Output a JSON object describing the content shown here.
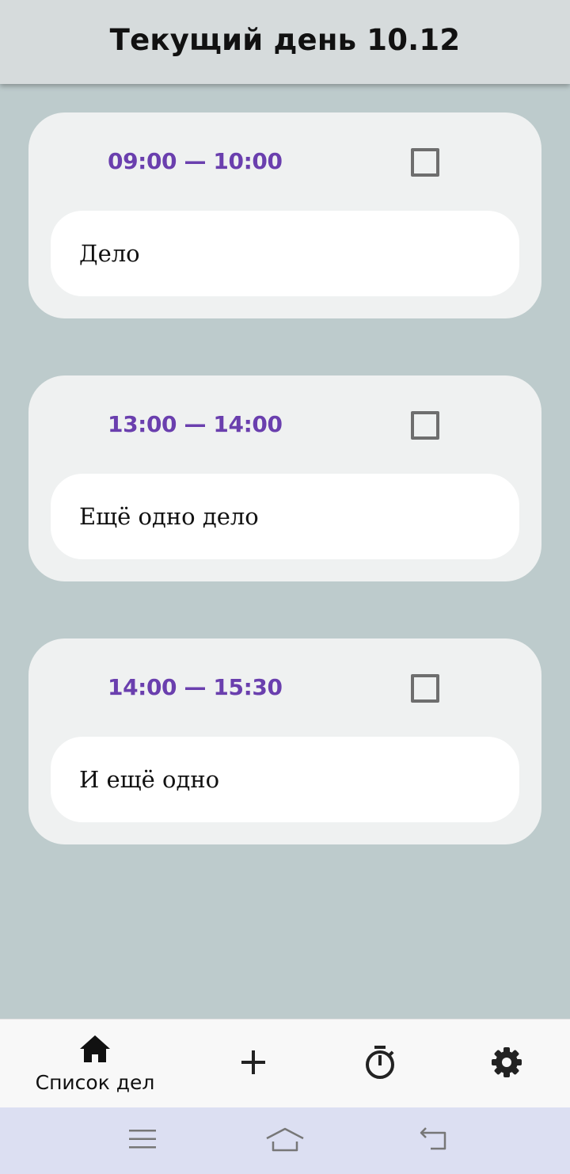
{
  "app_bar": {
    "title": "Текущий день 10.12"
  },
  "tasks": [
    {
      "time": "09:00 — 10:00",
      "text": "Дело",
      "done": false
    },
    {
      "time": "13:00 — 14:00",
      "text": "Ещё одно дело",
      "done": false
    },
    {
      "time": "14:00 — 15:30",
      "text": "И ещё одно",
      "done": false
    }
  ],
  "bottom_nav": {
    "items": [
      {
        "icon": "home-icon",
        "label": "Список дел",
        "active": true
      },
      {
        "icon": "plus-icon"
      },
      {
        "icon": "stopwatch-icon"
      },
      {
        "icon": "gear-icon"
      }
    ]
  },
  "system_nav": {
    "buttons": [
      "menu-icon",
      "home-outline-icon",
      "back-icon"
    ]
  },
  "colors": {
    "background": "#bdcbcc",
    "app_bar": "#d6dbdc",
    "card": "#eff1f1",
    "time_accent": "#6a3fae",
    "system_nav": "#dcdff2"
  }
}
